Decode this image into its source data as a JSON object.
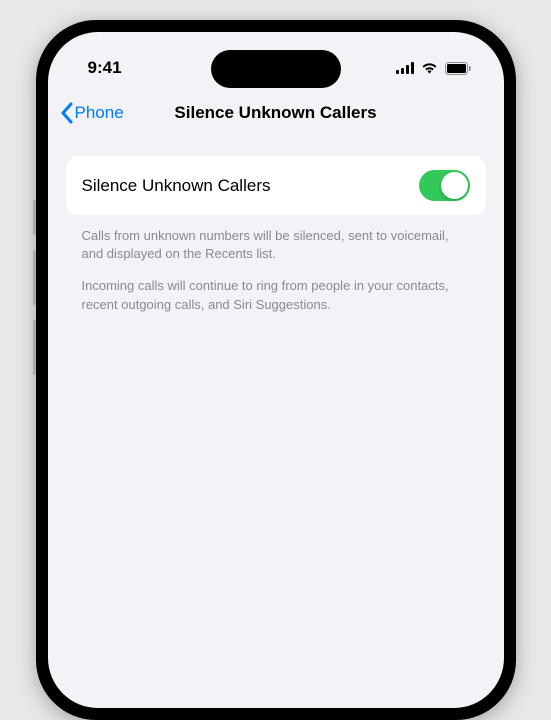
{
  "statusBar": {
    "time": "9:41"
  },
  "nav": {
    "backLabel": "Phone",
    "title": "Silence Unknown Callers"
  },
  "setting": {
    "label": "Silence Unknown Callers",
    "enabled": true
  },
  "description": {
    "paragraph1": "Calls from unknown numbers will be silenced, sent to voicemail, and displayed on the Recents list.",
    "paragraph2": "Incoming calls will continue to ring from people in your contacts, recent outgoing calls, and Siri Suggestions."
  },
  "colors": {
    "accent": "#007aff",
    "toggleOn": "#34c759",
    "background": "#f2f2f7"
  }
}
